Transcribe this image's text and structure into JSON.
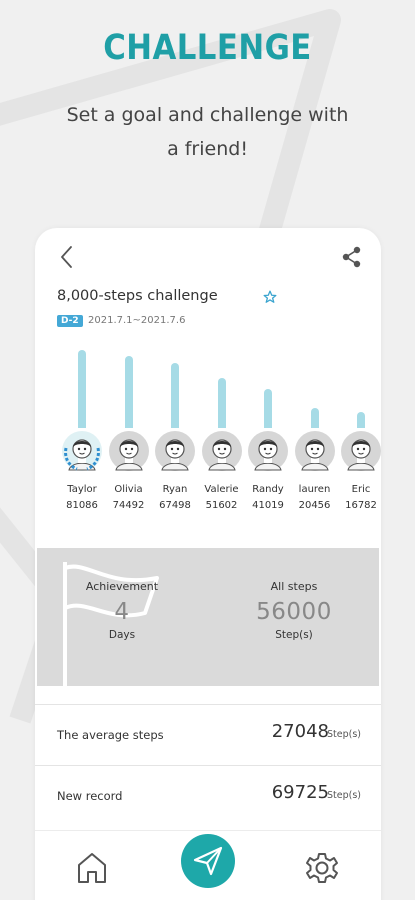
{
  "promo": {
    "title": "CHALLENGE",
    "subtitle": "Set a goal and challenge with a friend!"
  },
  "challenge": {
    "title": "8,000-steps challenge",
    "dday": "D-2",
    "dates": "2021.7.1~2021.7.6"
  },
  "ranking": [
    {
      "name": "Taylor",
      "steps": "81086",
      "value": 81086,
      "leader": true
    },
    {
      "name": "Olivia",
      "steps": "74492",
      "value": 74492,
      "leader": false
    },
    {
      "name": "Ryan",
      "steps": "67498",
      "value": 67498,
      "leader": false
    },
    {
      "name": "Valerie",
      "steps": "51602",
      "value": 51602,
      "leader": false
    },
    {
      "name": "Randy",
      "steps": "41019",
      "value": 41019,
      "leader": false
    },
    {
      "name": "lauren",
      "steps": "20456",
      "value": 20456,
      "leader": false
    },
    {
      "name": "Eric",
      "steps": "16782",
      "value": 16782,
      "leader": false
    }
  ],
  "summary": {
    "achievement_label": "Achievement",
    "achievement_value": "4",
    "achievement_unit": "Days",
    "all_steps_label": "All steps",
    "all_steps_value": "56000",
    "all_steps_unit": "Step(s)"
  },
  "stats": {
    "average_label": "The average steps",
    "average_value": "27048",
    "average_unit": "Step(s)",
    "record_label": "New record",
    "record_value": "69725",
    "record_unit": "Step(s)"
  },
  "colors": {
    "accent": "#1f9fa6",
    "bar": "#a6dbe6",
    "badge": "#44a8d6"
  },
  "icons": {
    "back": "chevron-left-icon",
    "share": "share-icon",
    "favorite": "star-icon",
    "home": "home-icon",
    "challenge": "paper-plane-icon",
    "settings": "gear-icon"
  }
}
